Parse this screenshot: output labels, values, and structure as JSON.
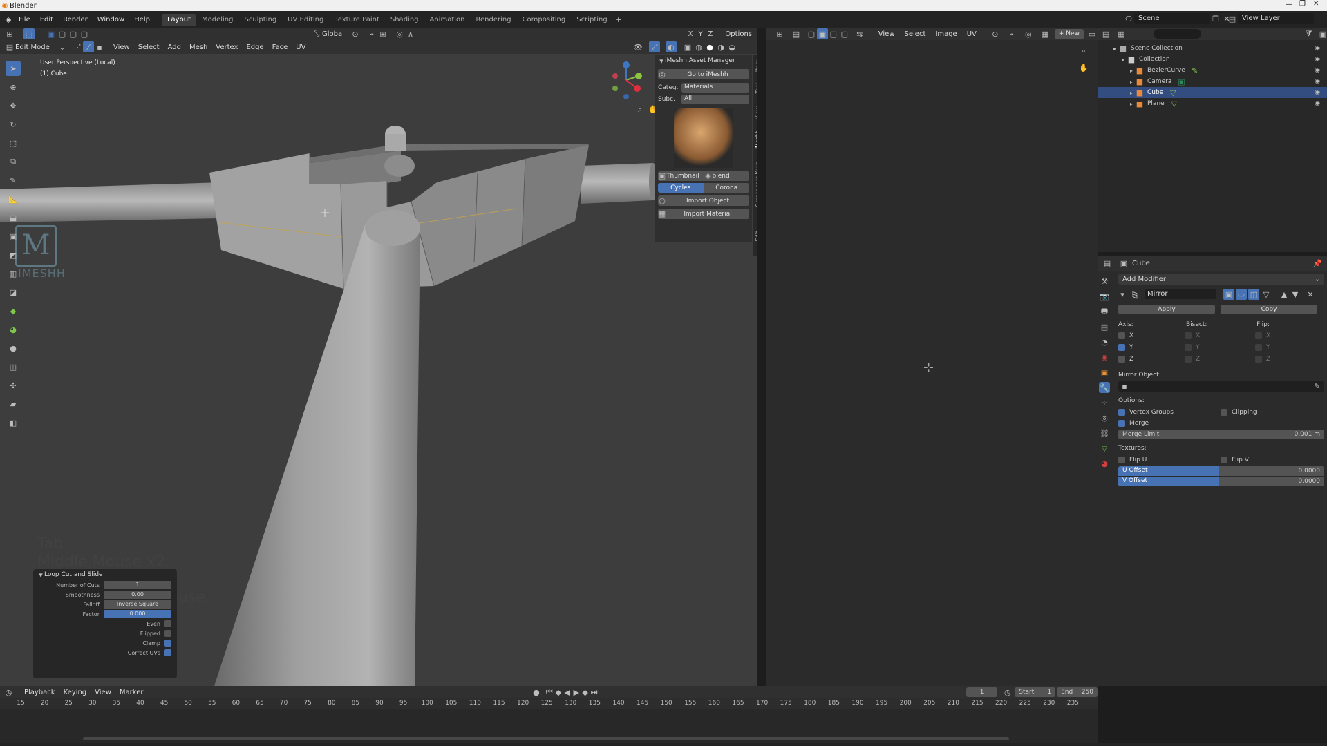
{
  "window": {
    "title": "Blender"
  },
  "menu": [
    "File",
    "Edit",
    "Render",
    "Window",
    "Help"
  ],
  "workspaces": [
    "Layout",
    "Modeling",
    "Sculpting",
    "UV Editing",
    "Texture Paint",
    "Shading",
    "Animation",
    "Rendering",
    "Compositing",
    "Scripting"
  ],
  "topbar_right": {
    "scene": "Scene",
    "view_layer": "View Layer"
  },
  "viewport": {
    "mode": "Edit Mode",
    "header_menu": [
      "View",
      "Select",
      "Add",
      "Mesh",
      "Vertex",
      "Edge",
      "Face",
      "UV"
    ],
    "orientation": "Global",
    "axes": [
      "X",
      "Y",
      "Z"
    ],
    "options": "Options",
    "overlay_line1": "User Perspective (Local)",
    "overlay_line2": "(1) Cube",
    "screencast": [
      "Tab",
      "Middle Mouse x2",
      "Middle Mouse"
    ],
    "logo_sub": "IMESHH"
  },
  "n_tabs": [
    "Item",
    "Tool",
    "View",
    "iMeshh",
    "Screencast Keys",
    "Edit"
  ],
  "asset_manager": {
    "title": "iMeshh Asset Manager",
    "go_button": "Go to iMeshh",
    "category_label": "Categ.",
    "category_value": "Materials",
    "subcat_label": "Subc.",
    "subcat_value": "All",
    "thumbnail_label": "Thumbnail",
    "blend_label": "blend",
    "engine_cycles": "Cycles",
    "engine_corona": "Corona",
    "import_object": "Import Object",
    "import_material": "Import Material"
  },
  "loopcut": {
    "title": "Loop Cut and Slide",
    "rows": [
      {
        "label": "Number of Cuts",
        "value": "1"
      },
      {
        "label": "Smoothness",
        "value": "0.00"
      },
      {
        "label": "Falloff",
        "value": "Inverse Square"
      },
      {
        "label": "Factor",
        "value": "0.000"
      }
    ],
    "checks": [
      {
        "label": "Even",
        "checked": false
      },
      {
        "label": "Flipped",
        "checked": false
      },
      {
        "label": "Clamp",
        "checked": true
      },
      {
        "label": "Correct UVs",
        "checked": true
      }
    ]
  },
  "image_editor": {
    "menu": [
      "View",
      "Select",
      "Image",
      "UV"
    ],
    "new_button": "New"
  },
  "outliner": {
    "root": "Scene Collection",
    "collection": "Collection",
    "items": [
      "BezierCurve",
      "Camera",
      "Cube",
      "Plane"
    ],
    "selected": "Cube"
  },
  "properties": {
    "object_name": "Cube",
    "add_modifier": "Add Modifier",
    "modifier_name": "Mirror",
    "apply": "Apply",
    "copy": "Copy",
    "axis_label": "Axis:",
    "bisect_label": "Bisect:",
    "flip_label": "Flip:",
    "axes": [
      "X",
      "Y",
      "Z"
    ],
    "axis_checked": [
      false,
      true,
      false
    ],
    "mirror_object_label": "Mirror Object:",
    "options_label": "Options:",
    "vertex_groups": "Vertex Groups",
    "clipping": "Clipping",
    "merge": "Merge",
    "merge_limit_label": "Merge Limit",
    "merge_limit_value": "0.001 m",
    "textures_label": "Textures:",
    "flip_u": "Flip U",
    "flip_v": "Flip V",
    "u_offset_label": "U Offset",
    "u_offset_value": "0.0000",
    "v_offset_label": "V Offset",
    "v_offset_value": "0.0000"
  },
  "timeline": {
    "menu": [
      "Playback",
      "Keying",
      "View",
      "Marker"
    ],
    "current_frame": "1",
    "start_label": "Start",
    "start_value": "1",
    "end_label": "End",
    "end_value": "250",
    "ticks": [
      "15",
      "20",
      "25",
      "30",
      "35",
      "40",
      "45",
      "50",
      "55",
      "60",
      "65",
      "70",
      "75",
      "80",
      "85",
      "90",
      "95",
      "100",
      "105",
      "110",
      "115",
      "120",
      "125",
      "130",
      "135",
      "140",
      "145",
      "150",
      "155",
      "160",
      "165",
      "170",
      "175",
      "180",
      "185",
      "190",
      "195",
      "200",
      "205",
      "210",
      "215",
      "220",
      "225",
      "230",
      "235"
    ]
  },
  "colors": {
    "accent": "#4772b3",
    "selected_row": "#334d80",
    "bg": "#303030",
    "viewport_bg": "#3d3d3d"
  }
}
